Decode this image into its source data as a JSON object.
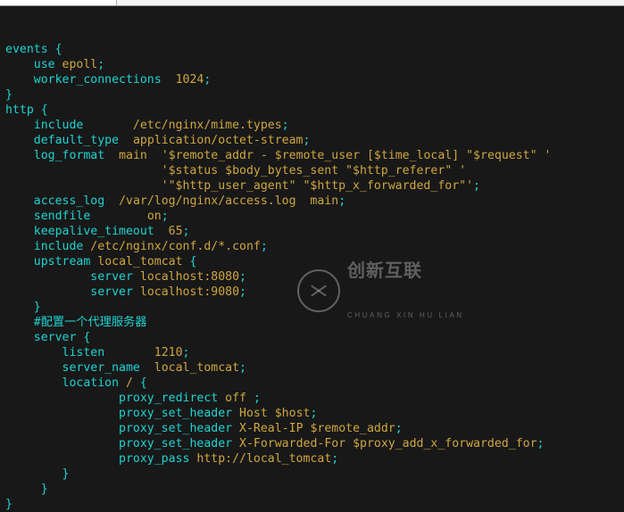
{
  "watermark": {
    "title": "创新互联",
    "subtitle": "CHUANG XIN HU LIAN"
  },
  "lines": [
    [
      [
        "kw",
        "events {"
      ]
    ],
    [
      [
        "white",
        "    "
      ],
      [
        "kw",
        "use"
      ],
      [
        "white",
        " "
      ],
      [
        "val",
        "epoll"
      ],
      [
        "kw",
        ";"
      ]
    ],
    [
      [
        "white",
        "    "
      ],
      [
        "kw",
        "worker_connections"
      ],
      [
        "white",
        "  "
      ],
      [
        "val",
        "1024"
      ],
      [
        "kw",
        ";"
      ]
    ],
    [
      [
        "kw",
        "}"
      ]
    ],
    [
      [
        "kw",
        "http {"
      ]
    ],
    [
      [
        "white",
        "    "
      ],
      [
        "kw",
        "include"
      ],
      [
        "white",
        "       "
      ],
      [
        "val",
        "/etc/nginx/mime.types"
      ],
      [
        "kw",
        ";"
      ]
    ],
    [
      [
        "white",
        "    "
      ],
      [
        "kw",
        "default_type"
      ],
      [
        "white",
        "  "
      ],
      [
        "val",
        "application/octet-stream"
      ],
      [
        "kw",
        ";"
      ]
    ],
    [
      [
        "white",
        "    "
      ],
      [
        "kw",
        "log_format"
      ],
      [
        "white",
        "  "
      ],
      [
        "val",
        "main"
      ],
      [
        "white",
        "  "
      ],
      [
        "val",
        "'$remote_addr - $remote_user [$time_local] \"$request\" '"
      ]
    ],
    [
      [
        "white",
        "                      "
      ],
      [
        "val",
        "'$status $body_bytes_sent \"$http_referer\" '"
      ]
    ],
    [
      [
        "white",
        "                      "
      ],
      [
        "val",
        "'\"$http_user_agent\" \"$http_x_forwarded_for\"'"
      ],
      [
        "kw",
        ";"
      ]
    ],
    [
      [
        "white",
        "    "
      ],
      [
        "kw",
        "access_log"
      ],
      [
        "white",
        "  "
      ],
      [
        "val",
        "/var/log/nginx/access.log  main"
      ],
      [
        "kw",
        ";"
      ]
    ],
    [
      [
        "white",
        "    "
      ],
      [
        "kw",
        "sendfile"
      ],
      [
        "white",
        "        "
      ],
      [
        "val",
        "on"
      ],
      [
        "kw",
        ";"
      ]
    ],
    [
      [
        "white",
        "    "
      ],
      [
        "kw",
        "keepalive_timeout"
      ],
      [
        "white",
        "  "
      ],
      [
        "val",
        "65"
      ],
      [
        "kw",
        ";"
      ]
    ],
    [
      [
        "white",
        "    "
      ],
      [
        "kw",
        "include"
      ],
      [
        "white",
        " "
      ],
      [
        "val",
        "/etc/nginx/conf.d/*.conf"
      ],
      [
        "kw",
        ";"
      ]
    ],
    [
      [
        "white",
        "    "
      ],
      [
        "kw",
        "upstream"
      ],
      [
        "white",
        " "
      ],
      [
        "val",
        "local_tomcat"
      ],
      [
        "white",
        " "
      ],
      [
        "kw",
        "{"
      ]
    ],
    [
      [
        "white",
        "            "
      ],
      [
        "kw",
        "server"
      ],
      [
        "white",
        " "
      ],
      [
        "val",
        "localhost:8080"
      ],
      [
        "kw",
        ";"
      ]
    ],
    [
      [
        "white",
        "            "
      ],
      [
        "kw",
        "server"
      ],
      [
        "white",
        " "
      ],
      [
        "val",
        "localhost:9080"
      ],
      [
        "kw",
        ";"
      ]
    ],
    [
      [
        "white",
        "    "
      ],
      [
        "kw",
        "}"
      ]
    ],
    [
      [
        "white",
        "    "
      ],
      [
        "comment",
        "#配置一个代理服务器"
      ]
    ],
    [
      [
        "white",
        "    "
      ],
      [
        "kw",
        "server"
      ],
      [
        "white",
        " "
      ],
      [
        "kw",
        "{"
      ]
    ],
    [
      [
        "white",
        "        "
      ],
      [
        "kw",
        "listen"
      ],
      [
        "white",
        "       "
      ],
      [
        "val",
        "1210"
      ],
      [
        "kw",
        ";"
      ]
    ],
    [
      [
        "white",
        "        "
      ],
      [
        "kw",
        "server_name"
      ],
      [
        "white",
        "  "
      ],
      [
        "val",
        "local_tomcat"
      ],
      [
        "kw",
        ";"
      ]
    ],
    [
      [
        "white",
        "        "
      ],
      [
        "kw",
        "location"
      ],
      [
        "white",
        " "
      ],
      [
        "val",
        "/"
      ],
      [
        "white",
        " "
      ],
      [
        "kw",
        "{"
      ]
    ],
    [
      [
        "white",
        "                "
      ],
      [
        "kw",
        "proxy_redirect"
      ],
      [
        "white",
        " "
      ],
      [
        "val",
        "off"
      ],
      [
        "white",
        " "
      ],
      [
        "kw",
        ";"
      ]
    ],
    [
      [
        "white",
        "                "
      ],
      [
        "kw",
        "proxy_set_header"
      ],
      [
        "white",
        " "
      ],
      [
        "val",
        "Host $host"
      ],
      [
        "kw",
        ";"
      ]
    ],
    [
      [
        "white",
        "                "
      ],
      [
        "kw",
        "proxy_set_header"
      ],
      [
        "white",
        " "
      ],
      [
        "val",
        "X-Real-IP $remote_addr"
      ],
      [
        "kw",
        ";"
      ]
    ],
    [
      [
        "white",
        "                "
      ],
      [
        "kw",
        "proxy_set_header"
      ],
      [
        "white",
        " "
      ],
      [
        "val",
        "X-Forwarded-For $proxy_add_x_forwarded_for"
      ],
      [
        "kw",
        ";"
      ]
    ],
    [
      [
        "white",
        "                "
      ],
      [
        "kw",
        "proxy_pass"
      ],
      [
        "white",
        " "
      ],
      [
        "val",
        "http://local_tomcat"
      ],
      [
        "kw",
        ";"
      ]
    ],
    [
      [
        "white",
        "        "
      ],
      [
        "kw",
        "}"
      ]
    ],
    [
      [
        "white",
        "     "
      ],
      [
        "kw",
        "}"
      ]
    ],
    [
      [
        "kw",
        "}"
      ]
    ]
  ]
}
